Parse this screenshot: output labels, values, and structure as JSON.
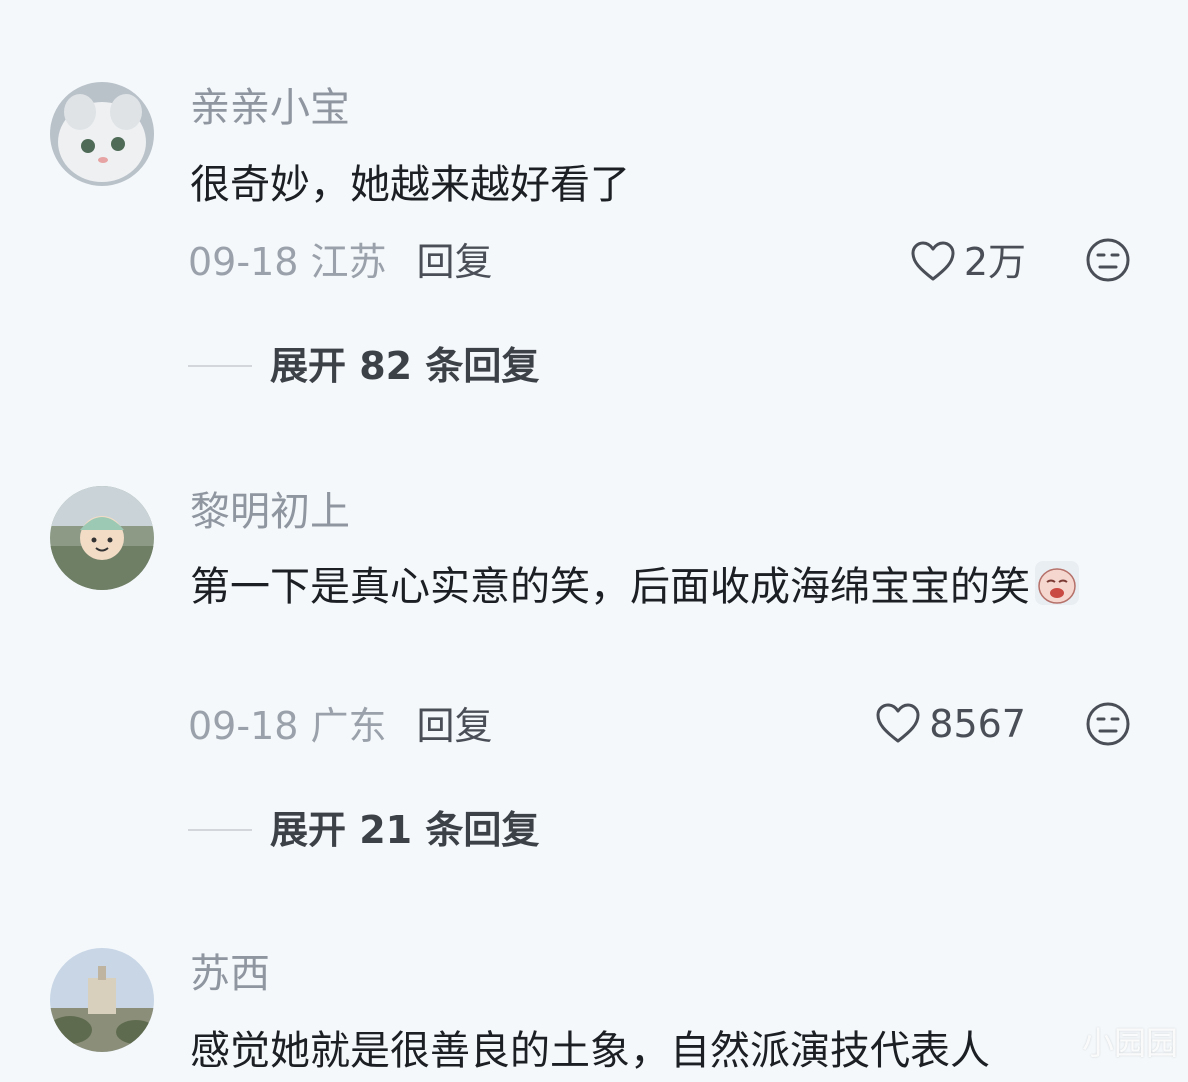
{
  "comments": [
    {
      "username": "亲亲小宝",
      "text": "很奇妙，她越来越好看了",
      "date_location": "09-18 江苏",
      "reply_label": "回复",
      "likes": "2万",
      "expand_label": "展开 82 条回复"
    },
    {
      "username": "黎明初上",
      "text": "第一下是真心实意的笑，后面收成海绵宝宝的笑",
      "date_location": "09-18 广东",
      "reply_label": "回复",
      "likes": "8567",
      "expand_label": "展开 21 条回复"
    },
    {
      "username": "苏西",
      "text": "感觉她就是很善良的土象，自然派演技代表人"
    }
  ],
  "watermark": "小园园",
  "colors": {
    "background": "#f4f8fb",
    "username": "#8f96a0",
    "content": "#1c1f23",
    "meta": "#9aa1aa"
  }
}
